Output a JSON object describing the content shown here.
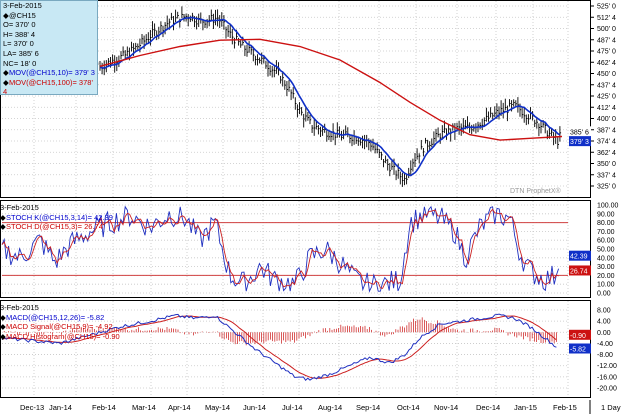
{
  "panel1": {
    "date": "3-Feb-2015",
    "symbol": "@CH15",
    "open": "O= 370' 0",
    "high": "H= 388' 4",
    "low": "L= 370' 0",
    "last": "LA= 385' 6",
    "net_change": "NC= 18' 0",
    "ma10_label": "MOV(@CH15,10)= 379' 3",
    "ma100_label": "MOV(@CH15,100)= 378' 4",
    "watermark": "DTN ProphetX®",
    "price_ticks": [
      "525' 0",
      "512' 4",
      "500' 0",
      "487' 4",
      "475' 0",
      "462' 4",
      "450' 0",
      "437' 4",
      "425' 0",
      "412' 4",
      "400' 0",
      "387' 4",
      "374' 4",
      "362' 4",
      "350' 0",
      "337' 4",
      "325' 0"
    ],
    "last_box": "385' 6",
    "ma_box": "379' 3",
    "colors": {
      "price": "#000000",
      "ma10": "#0000cc",
      "ma100": "#cc0000",
      "legend_bg": "#c8e8f4"
    }
  },
  "panel2": {
    "date": "3-Feb-2015",
    "stoch_k_label": "STOCH K(@CH15,3,14)= 42.39",
    "stoch_d_label": "STOCH D(@CH15,3)= 26.74",
    "ticks": [
      "100.00",
      "90.00",
      "80.00",
      "70.00",
      "60.00",
      "50.00",
      "40.00",
      "30.00",
      "20.00",
      "10.00",
      "0.00"
    ],
    "k_box": "42.39",
    "d_box": "26.74"
  },
  "panel3": {
    "date": "3-Feb-2015",
    "macd_label": "MACD(@CH15,12,26)= -5.82",
    "signal_label": "MACD Signal(@CH15,9)= -4.92",
    "hist_label": "MACD Histogram(@CH15)= -0.90",
    "ticks": [
      "8.00",
      "4.00",
      "0.00",
      "-4.00",
      "-8.00",
      "-12.00",
      "-16.00",
      "-20.00"
    ],
    "hist_box": "-0.90",
    "macd_box": "-5.82"
  },
  "x_axis": {
    "months": [
      "Dec-13",
      "Jan-14",
      "Feb-14",
      "Mar-14",
      "Apr-14",
      "May-14",
      "Jun-14",
      "Jul-14",
      "Aug-14",
      "Sep-14",
      "Oct-14",
      "Nov-14",
      "Dec-14",
      "Jan-15",
      "Feb-15"
    ],
    "period": "1 Day"
  }
}
